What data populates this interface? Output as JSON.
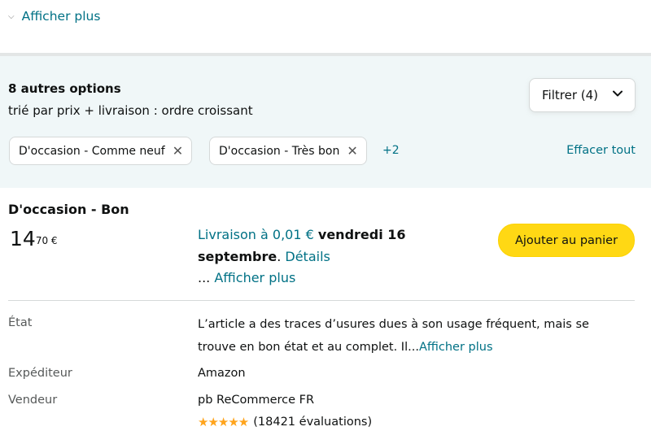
{
  "top": {
    "show_more": "Afficher plus"
  },
  "offers_header": {
    "title": "8 autres options",
    "subtitle": "trié par prix + livraison : ordre croissant",
    "filter_label": "Filtrer (4)",
    "chips": [
      "D'occasion - Comme neuf",
      "D'occasion - Très bon"
    ],
    "more_count": "+2",
    "clear_all": "Effacer tout"
  },
  "offer": {
    "condition": "D'occasion - Bon",
    "price_whole": "14",
    "price_fraction": "70 €",
    "delivery_prefix": "Livraison à 0,01 €",
    "delivery_date": "vendredi 16 septembre",
    "delivery_period": ".",
    "details_link": "Détails",
    "ellipsis": "...",
    "show_more": "Afficher plus",
    "add_to_cart": "Ajouter au panier",
    "etat_label": "État",
    "etat_text": "L’article a des traces d’usures dues à son usage fréquent, mais se trouve en bon état et au complet. Il...",
    "etat_more": "Afficher plus",
    "shipper_label": "Expéditeur",
    "shipper_value": "Amazon",
    "seller_label": "Vendeur",
    "seller_name": "pb ReCommerce FR",
    "rating_stars": 5,
    "rating_count": "(18421 évaluations)"
  },
  "colors": {
    "link": "#007185",
    "panel_bg": "#f0f7f8",
    "cart_button": "#ffd814",
    "star": "#ffa41c"
  }
}
